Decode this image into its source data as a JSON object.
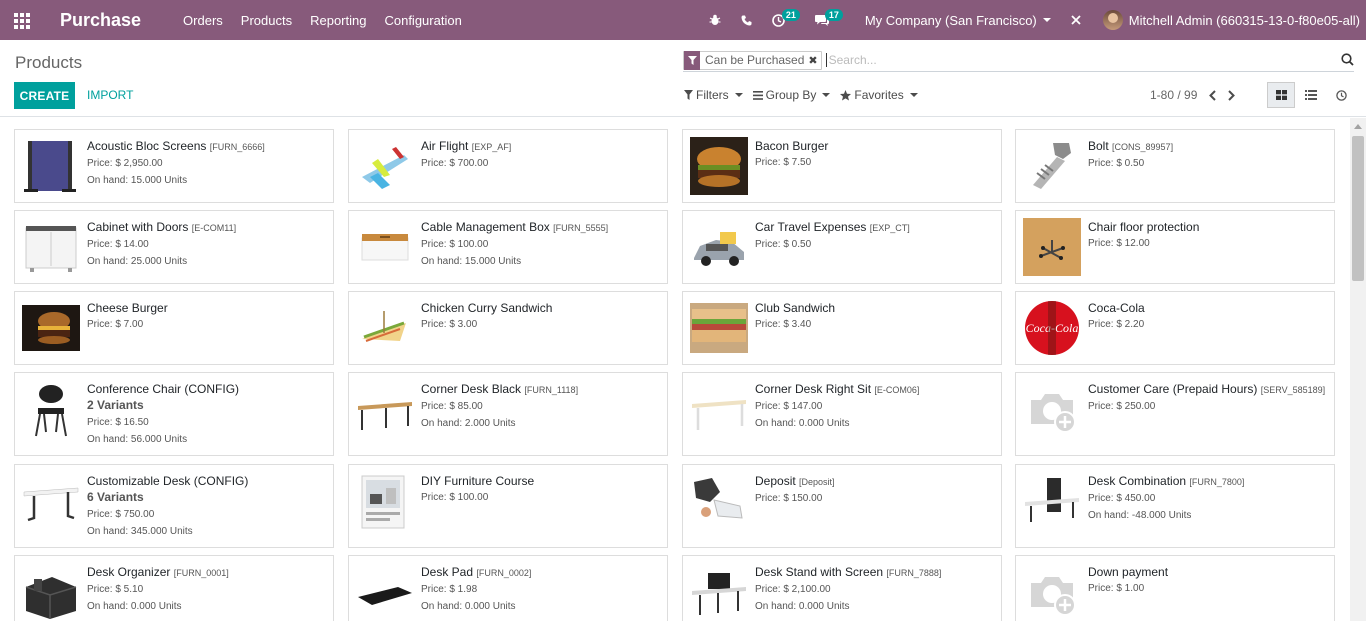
{
  "app": {
    "title": "Purchase"
  },
  "menu": [
    "Orders",
    "Products",
    "Reporting",
    "Configuration"
  ],
  "systray": {
    "activity_count": "21",
    "message_count": "17",
    "company": "My Company (San Francisco)",
    "user": "Mitchell Admin (660315-13-0-f80e05-all)"
  },
  "breadcrumb": "Products",
  "buttons": {
    "create": "CREATE",
    "import": "IMPORT"
  },
  "search": {
    "facet": "Can be Purchased",
    "placeholder": "Search..."
  },
  "filters": {
    "filters": "Filters",
    "group_by": "Group By",
    "favorites": "Favorites"
  },
  "pager": "1-80 / 99",
  "colors": {
    "brand": "#875a7b",
    "accent": "#00a09d"
  },
  "products": [
    {
      "name": "Acoustic Bloc Screens",
      "code": "[FURN_6666]",
      "variants": "",
      "price": "Price: $ 2,950.00",
      "onhand": "On hand: 15.000 Units",
      "icon": "acoustic-screen-image"
    },
    {
      "name": "Air Flight",
      "code": "[EXP_AF]",
      "variants": "",
      "price": "Price: $ 700.00",
      "onhand": "",
      "icon": "airplane-image"
    },
    {
      "name": "Bacon Burger",
      "code": "",
      "variants": "",
      "price": "Price: $ 7.50",
      "onhand": "",
      "icon": "burger-image"
    },
    {
      "name": "Bolt",
      "code": "[CONS_89957]",
      "variants": "",
      "price": "Price: $ 0.50",
      "onhand": "",
      "icon": "bolt-image"
    },
    {
      "name": "Cabinet with Doors",
      "code": "[E-COM11]",
      "variants": "",
      "price": "Price: $ 14.00",
      "onhand": "On hand: 25.000 Units",
      "icon": "cabinet-image"
    },
    {
      "name": "Cable Management Box",
      "code": "[FURN_5555]",
      "variants": "",
      "price": "Price: $ 100.00",
      "onhand": "On hand: 15.000 Units",
      "icon": "cable-box-image"
    },
    {
      "name": "Car Travel Expenses",
      "code": "[EXP_CT]",
      "variants": "",
      "price": "Price: $ 0.50",
      "onhand": "",
      "icon": "car-image"
    },
    {
      "name": "Chair floor protection",
      "code": "",
      "variants": "",
      "price": "Price: $ 12.00",
      "onhand": "",
      "icon": "chair-floor-image"
    },
    {
      "name": "Cheese Burger",
      "code": "",
      "variants": "",
      "price": "Price: $ 7.00",
      "onhand": "",
      "icon": "cheese-burger-image"
    },
    {
      "name": "Chicken Curry Sandwich",
      "code": "",
      "variants": "",
      "price": "Price: $ 3.00",
      "onhand": "",
      "icon": "sandwich-image"
    },
    {
      "name": "Club Sandwich",
      "code": "",
      "variants": "",
      "price": "Price: $ 3.40",
      "onhand": "",
      "icon": "club-sandwich-image"
    },
    {
      "name": "Coca-Cola",
      "code": "",
      "variants": "",
      "price": "Price: $ 2.20",
      "onhand": "",
      "icon": "coca-cola-image"
    },
    {
      "name": "Conference Chair (CONFIG)",
      "code": "",
      "variants": "2 Variants",
      "price": "Price: $ 16.50",
      "onhand": "On hand: 56.000 Units",
      "icon": "chair-image"
    },
    {
      "name": "Corner Desk Black",
      "code": "[FURN_1118]",
      "variants": "",
      "price": "Price: $ 85.00",
      "onhand": "On hand: 2.000 Units",
      "icon": "desk-black-image"
    },
    {
      "name": "Corner Desk Right Sit",
      "code": "[E-COM06]",
      "variants": "",
      "price": "Price: $ 147.00",
      "onhand": "On hand: 0.000 Units",
      "icon": "desk-white-image"
    },
    {
      "name": "Customer Care (Prepaid Hours)",
      "code": "[SERV_585189]",
      "variants": "",
      "price": "Price: $ 250.00",
      "onhand": "",
      "icon": "placeholder-camera-image"
    },
    {
      "name": "Customizable Desk (CONFIG)",
      "code": "",
      "variants": "6 Variants",
      "price": "Price: $ 750.00",
      "onhand": "On hand: 345.000 Units",
      "icon": "custom-desk-image"
    },
    {
      "name": "DIY Furniture Course",
      "code": "",
      "variants": "",
      "price": "Price: $ 100.00",
      "onhand": "",
      "icon": "course-image"
    },
    {
      "name": "Deposit",
      "code": "[Deposit]",
      "variants": "",
      "price": "Price: $ 150.00",
      "onhand": "",
      "icon": "deposit-image"
    },
    {
      "name": "Desk Combination",
      "code": "[FURN_7800]",
      "variants": "",
      "price": "Price: $ 450.00",
      "onhand": "On hand: -48.000 Units",
      "icon": "desk-combination-image"
    },
    {
      "name": "Desk Organizer",
      "code": "[FURN_0001]",
      "variants": "",
      "price": "Price: $ 5.10",
      "onhand": "On hand: 0.000 Units",
      "icon": "organizer-image"
    },
    {
      "name": "Desk Pad",
      "code": "[FURN_0002]",
      "variants": "",
      "price": "Price: $ 1.98",
      "onhand": "On hand: 0.000 Units",
      "icon": "desk-pad-image"
    },
    {
      "name": "Desk Stand with Screen",
      "code": "[FURN_7888]",
      "variants": "",
      "price": "Price: $ 2,100.00",
      "onhand": "On hand: 0.000 Units",
      "icon": "desk-stand-image"
    },
    {
      "name": "Down payment",
      "code": "",
      "variants": "",
      "price": "Price: $ 1.00",
      "onhand": "",
      "icon": "placeholder-camera-image"
    }
  ]
}
